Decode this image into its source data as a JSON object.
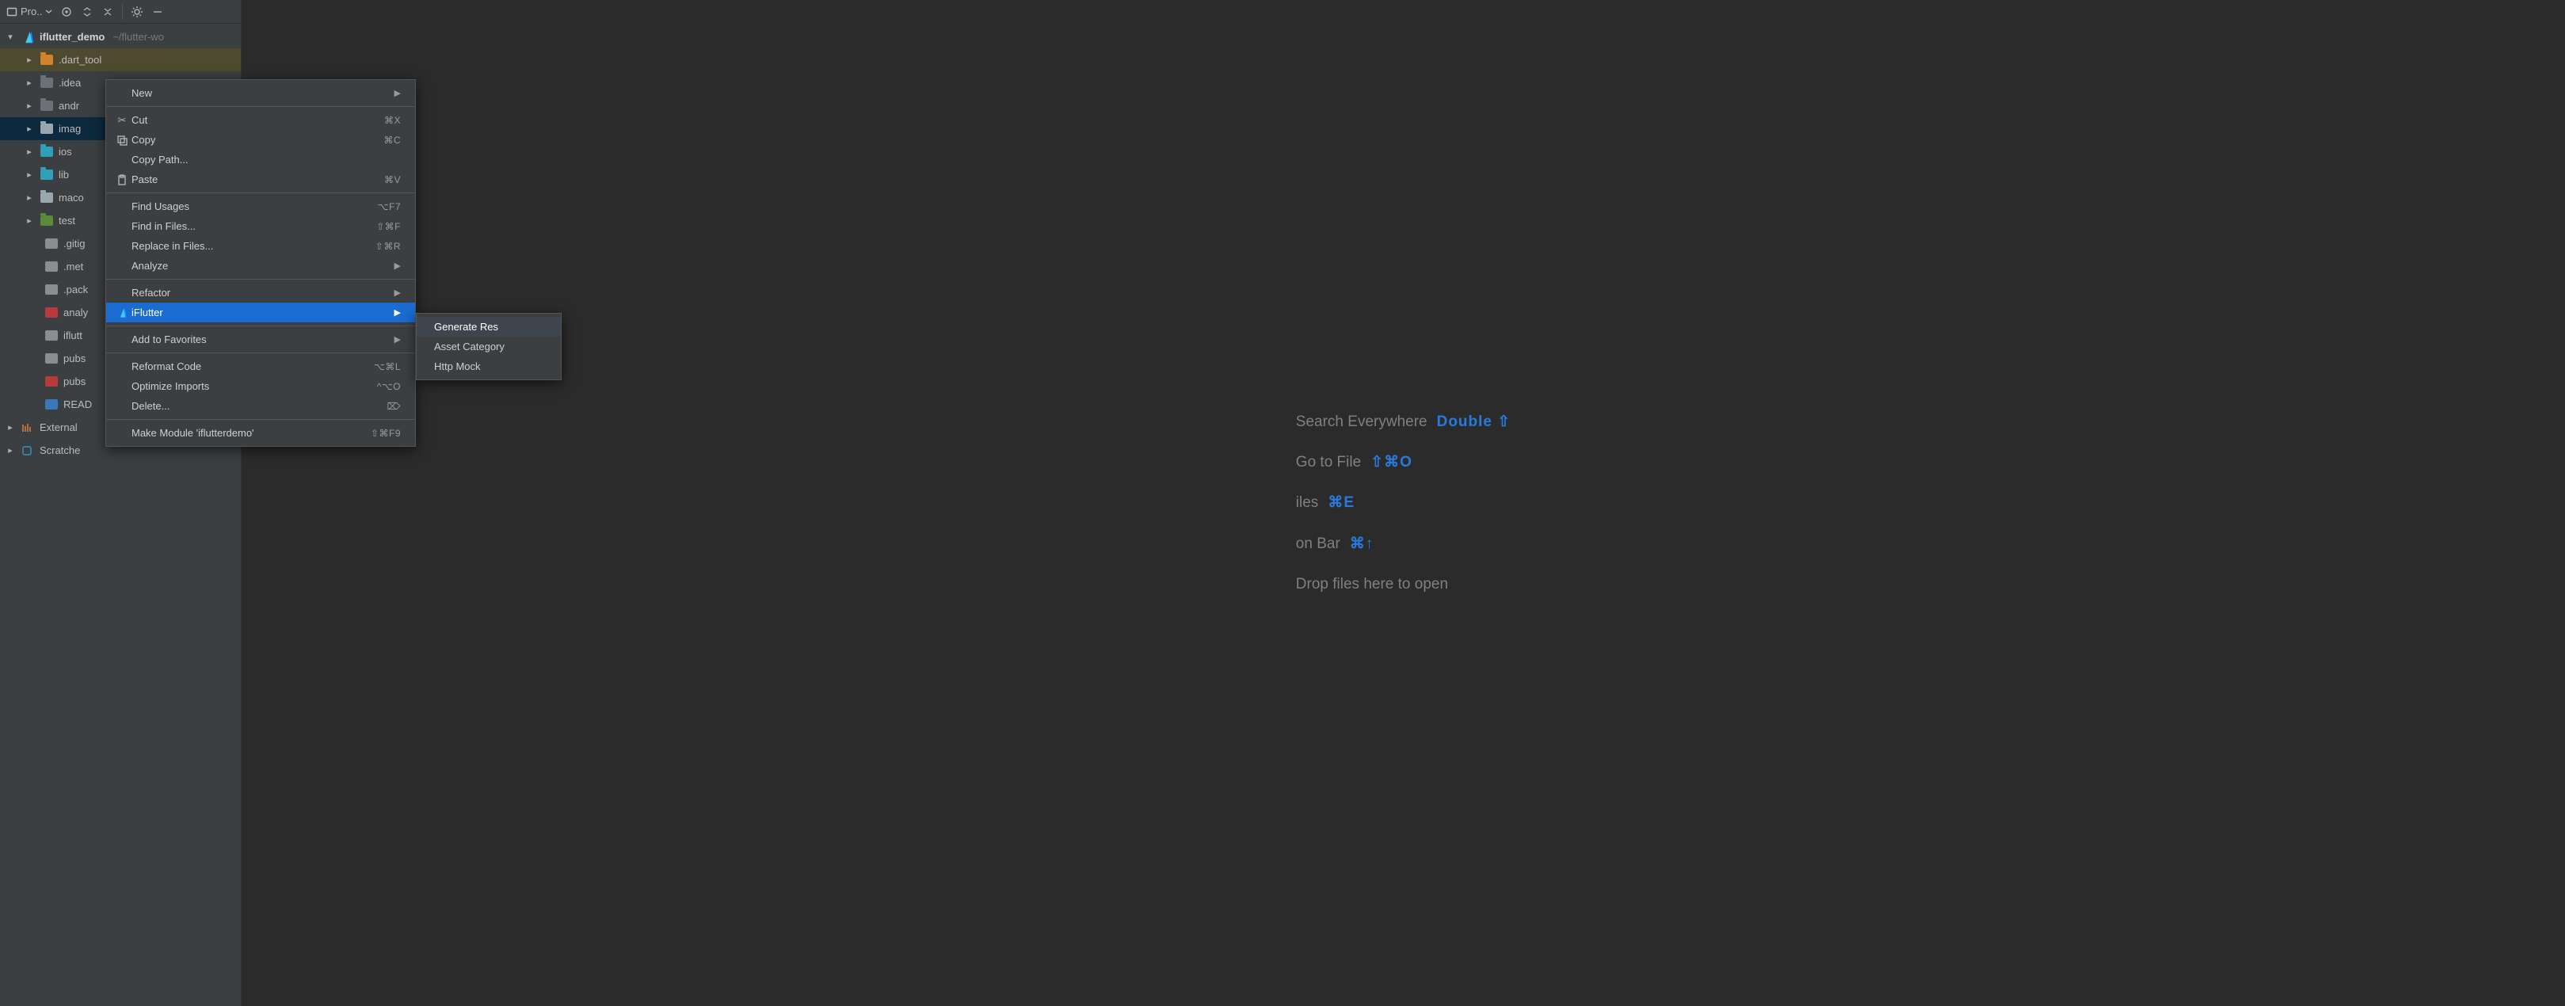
{
  "toolwindow": {
    "title": "Pro.."
  },
  "tree": {
    "root": {
      "label": "iflutter_demo",
      "sub": "~/flutter-wo"
    },
    "dart_tool": {
      "label": ".dart_tool"
    },
    "idea": {
      "label": ".idea"
    },
    "android": {
      "label": "andr"
    },
    "images": {
      "label": "imag"
    },
    "ios": {
      "label": "ios"
    },
    "lib": {
      "label": "lib"
    },
    "macos": {
      "label": "maco"
    },
    "test": {
      "label": "test"
    },
    "gitignore": {
      "label": ".gitig"
    },
    "metadata": {
      "label": ".met"
    },
    "packages": {
      "label": ".pack"
    },
    "analysis": {
      "label": "analy"
    },
    "iflutter": {
      "label": "iflutt"
    },
    "pubslock": {
      "label": "pubs"
    },
    "pubspec": {
      "label": "pubs"
    },
    "readme": {
      "label": "READ"
    },
    "external": {
      "label": "External"
    },
    "scratches": {
      "label": "Scratche"
    }
  },
  "ctx": {
    "new": {
      "label": "New"
    },
    "cut": {
      "label": "Cut",
      "sc": "⌘X"
    },
    "copy": {
      "label": "Copy",
      "sc": "⌘C"
    },
    "copypath": {
      "label": "Copy Path..."
    },
    "paste": {
      "label": "Paste",
      "sc": "⌘V"
    },
    "findusages": {
      "label": "Find Usages",
      "sc": "⌥F7"
    },
    "findfiles": {
      "label": "Find in Files...",
      "sc": "⇧⌘F"
    },
    "replace": {
      "label": "Replace in Files...",
      "sc": "⇧⌘R"
    },
    "analyze": {
      "label": "Analyze"
    },
    "refactor": {
      "label": "Refactor"
    },
    "iflutter": {
      "label": "iFlutter"
    },
    "favorites": {
      "label": "Add to Favorites"
    },
    "reformat": {
      "label": "Reformat Code",
      "sc": "⌥⌘L"
    },
    "optimize": {
      "label": "Optimize Imports",
      "sc": "^⌥O"
    },
    "delete": {
      "label": "Delete...",
      "sc": "⌦"
    },
    "makemodule": {
      "label": "Make Module 'iflutterdemo'",
      "sc": "⇧⌘F9"
    }
  },
  "submenu": {
    "gen": {
      "label": "Generate Res"
    },
    "asset": {
      "label": "Asset Category"
    },
    "http": {
      "label": "Http Mock"
    }
  },
  "placeholder": {
    "search": {
      "label": "Search Everywhere",
      "kb": "Double ⇧"
    },
    "gofile": {
      "label": "Go to File",
      "kb": "⇧⌘O"
    },
    "files": {
      "label": "iles",
      "kb": "⌘E"
    },
    "navbar": {
      "label": "on Bar",
      "kb": "⌘↑"
    },
    "drop": {
      "label": "Drop files here to open"
    }
  }
}
